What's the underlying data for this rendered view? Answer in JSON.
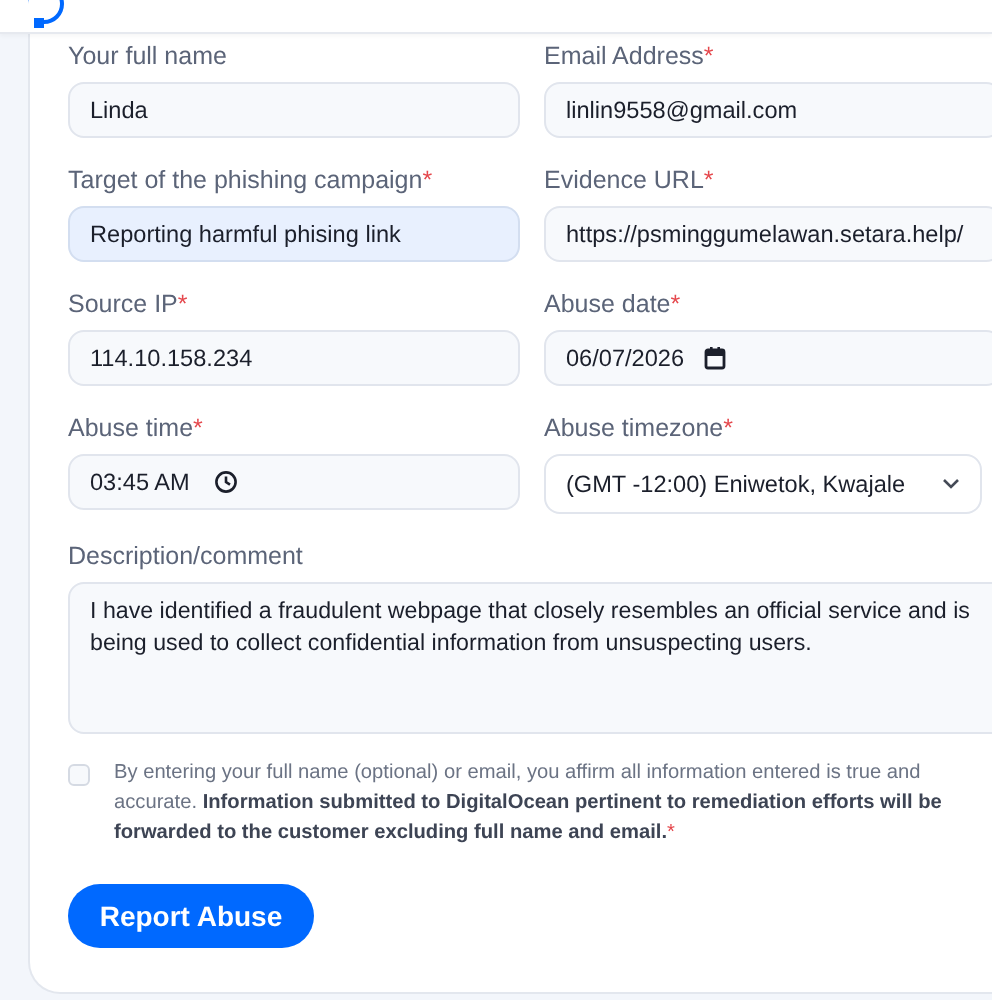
{
  "header": {
    "logo": true
  },
  "form": {
    "fields": [
      {
        "kind": "text",
        "label": "Your full name",
        "value": "Linda",
        "highlighted": false
      },
      {
        "kind": "text",
        "label": "Email Address",
        "required_mark": "*",
        "value": "linlin9558@gmail.com",
        "highlighted": false
      },
      {
        "kind": "text",
        "label": "Target of the phishing campaign",
        "required_mark": "*",
        "value": "Reporting harmful phising link",
        "highlighted": true
      },
      {
        "kind": "text",
        "label": "Evidence URL",
        "required_mark": "*",
        "value": "https://psminggumelawan.setara.help/",
        "highlighted": false
      },
      {
        "kind": "text",
        "label": "Source IP",
        "required_mark": "*",
        "value": "114.10.158.234",
        "highlighted": false
      },
      {
        "kind": "date",
        "label": "Abuse date",
        "required_mark": "*",
        "value": "06/07/2026",
        "highlighted": false
      },
      {
        "kind": "time",
        "label": "Abuse time",
        "required_mark": "*",
        "value": "03:45 AM",
        "highlighted": false
      },
      {
        "kind": "select",
        "label": "Abuse timezone",
        "required_mark": "*",
        "value": "(GMT -12:00) Eniwetok, Kwajale"
      },
      {
        "kind": "textarea",
        "label": "Description/comment",
        "value": "I have identified a fraudulent webpage that closely resembles an official service and is being used to collect confidential information from unsuspecting users.",
        "highlighted": false
      }
    ],
    "consent": {
      "checked": false,
      "text": "By entering your full name (optional) or email, you affirm all information entered is true and accurate. **Information submitted to DigitalOcean pertinent to remediation efforts will be forwarded to the customer excluding full name and email.**",
      "required_mark": "*"
    },
    "submit": "Report Abuse"
  }
}
